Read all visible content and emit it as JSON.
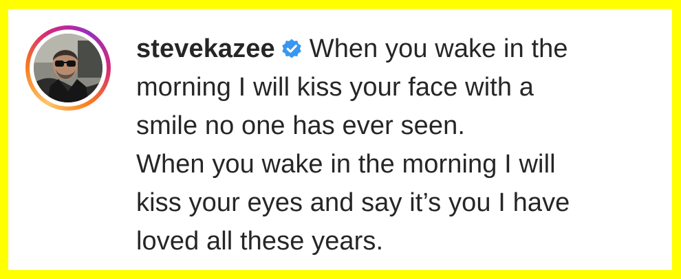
{
  "post": {
    "username": "stevekazee",
    "verified_icon": "verified-badge-icon",
    "badge_color": "#3897f0",
    "caption_lines": [
      "When you wake in the",
      "morning I will kiss your face with a",
      "smile no one has ever seen.",
      "When you wake in the morning I will",
      "kiss your eyes and say it’s you I have",
      "loved all these years."
    ]
  },
  "colors": {
    "frame_border": "#ffff00",
    "background": "#ffffff",
    "text": "#262626"
  }
}
